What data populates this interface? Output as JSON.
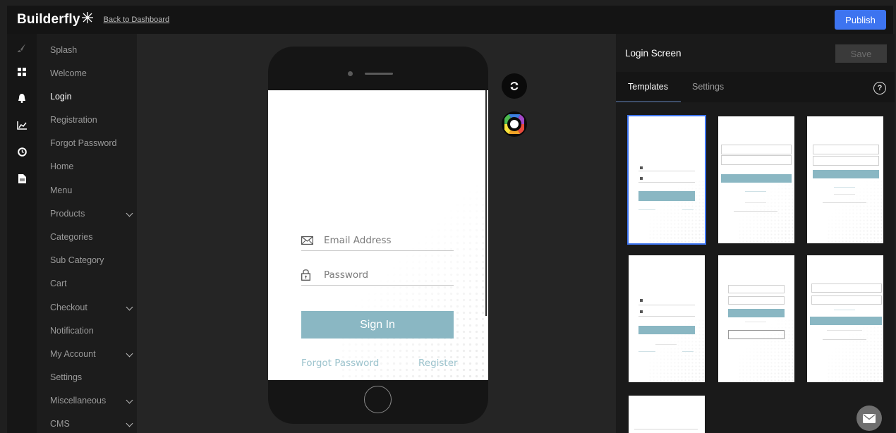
{
  "header": {
    "logo_text": "Builderfly",
    "back_link": "Back to Dashboard",
    "publish_label": "Publish"
  },
  "rail": {
    "icons": [
      "brush-icon",
      "dashboard-icon",
      "bell-icon",
      "chart-icon",
      "clock-icon",
      "document-icon"
    ]
  },
  "nav": {
    "items": [
      {
        "label": "Splash",
        "expandable": false
      },
      {
        "label": "Welcome",
        "expandable": false
      },
      {
        "label": "Login",
        "expandable": false,
        "active": true
      },
      {
        "label": "Registration",
        "expandable": false
      },
      {
        "label": "Forgot Password",
        "expandable": false
      },
      {
        "label": "Home",
        "expandable": false
      },
      {
        "label": "Menu",
        "expandable": false
      },
      {
        "label": "Products",
        "expandable": true
      },
      {
        "label": "Categories",
        "expandable": false
      },
      {
        "label": "Sub Category",
        "expandable": false
      },
      {
        "label": "Cart",
        "expandable": false
      },
      {
        "label": "Checkout",
        "expandable": true
      },
      {
        "label": "Notification",
        "expandable": false
      },
      {
        "label": "My Account",
        "expandable": true
      },
      {
        "label": "Settings",
        "expandable": false
      },
      {
        "label": "Miscellaneous",
        "expandable": true
      },
      {
        "label": "CMS",
        "expandable": true
      }
    ]
  },
  "phone": {
    "email_placeholder": "Email Address",
    "password_placeholder": "Password",
    "signin_label": "Sign In",
    "forgot_link": "Forgot Password",
    "register_link": "Register",
    "accent_color": "#8ab7c3"
  },
  "panel": {
    "title": "Login Screen",
    "save_label": "Save",
    "tabs": [
      {
        "label": "Templates",
        "active": true
      },
      {
        "label": "Settings",
        "active": false
      }
    ],
    "help_label": "?"
  },
  "colors": {
    "publish": "#3d74f0",
    "background": "#1f1f1f"
  }
}
